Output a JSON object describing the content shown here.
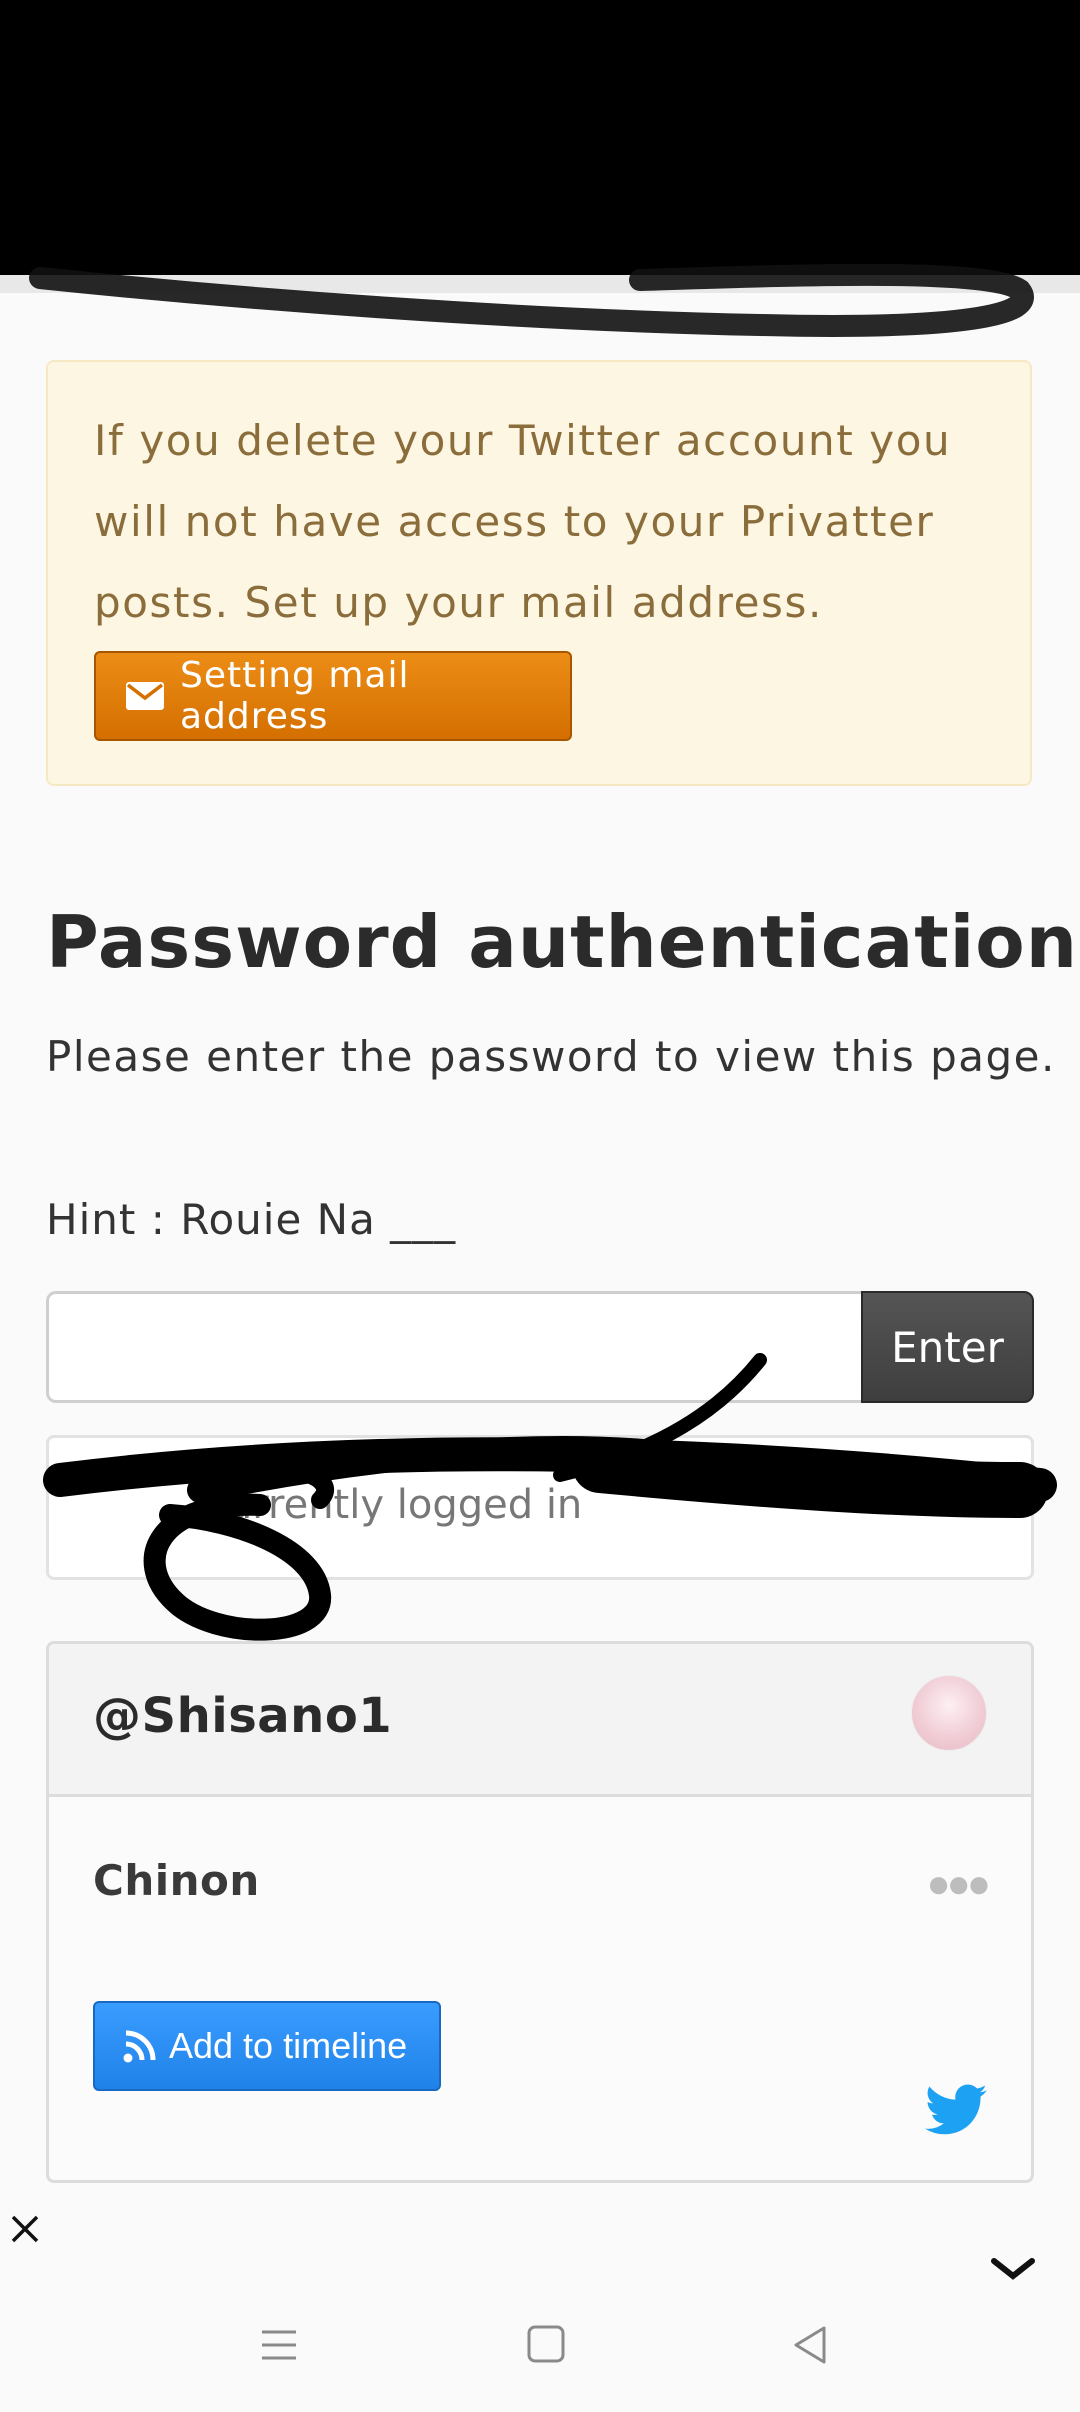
{
  "banner": {
    "message": "If you delete your Twitter account you will not have access to your Privatter posts. Set up your mail address.",
    "button_label": "Setting mail address",
    "button_icon": "envelope-icon"
  },
  "auth": {
    "title": "Password authentication",
    "description": "Please enter the password to view this page.",
    "hint": "Hint : Rouie Na ___",
    "input_value": "",
    "enter_label": "Enter",
    "login_status": "Currently logged in"
  },
  "profile": {
    "handle": "@Shisano1",
    "name": "Chinon",
    "timeline_label": "Add to timeline",
    "timeline_icon": "rss-icon",
    "brand_icon": "twitter-bird-icon",
    "more_icon": "more-dots-icon"
  },
  "colors": {
    "alert_bg": "#fdf6e3",
    "alert_text": "#8a6d3b",
    "orange": "#e07b00",
    "blue": "#2a8ff5",
    "twitter": "#1da1f2"
  },
  "system_nav": {
    "icons": [
      "menu-icon",
      "home-square-icon",
      "back-triangle-icon"
    ]
  }
}
